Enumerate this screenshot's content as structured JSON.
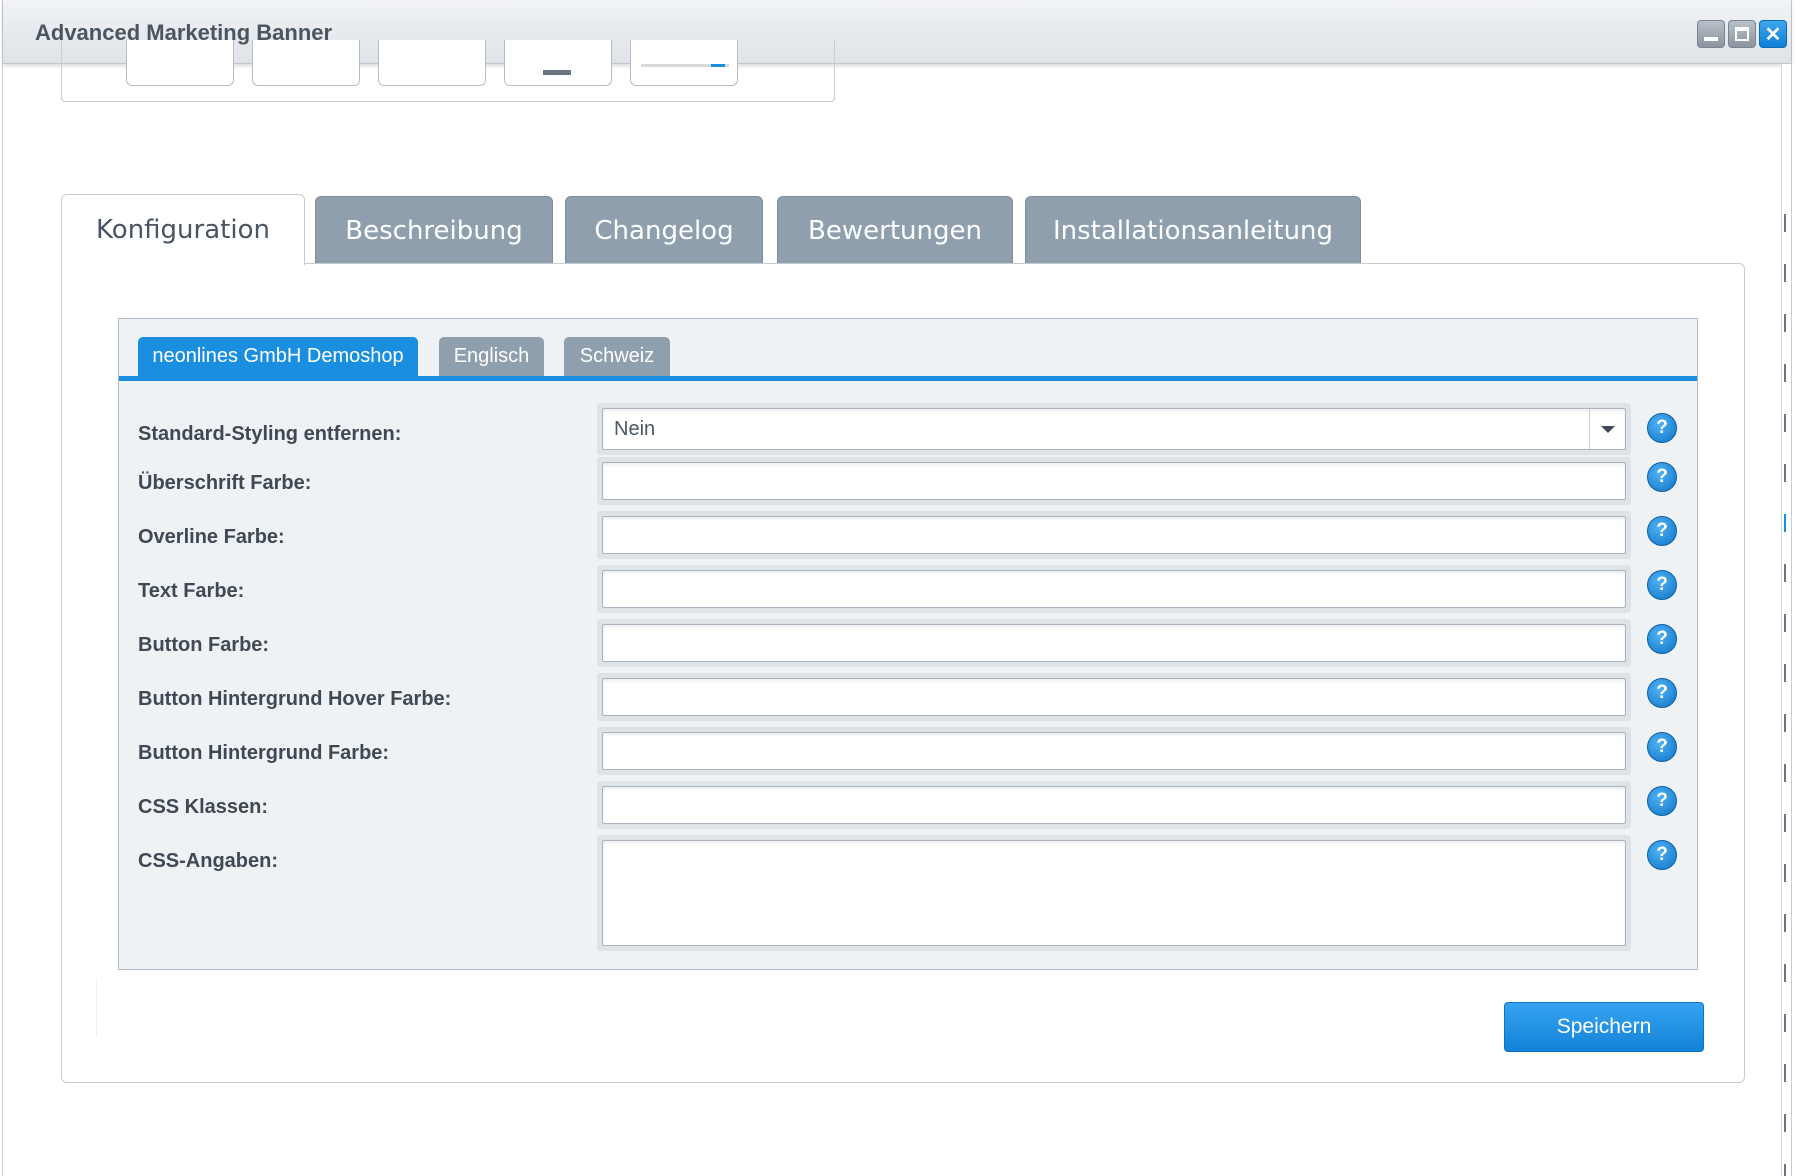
{
  "window": {
    "title": "Advanced Marketing Banner",
    "controls": [
      "minimize-icon",
      "maximize-icon",
      "close-icon"
    ]
  },
  "main_tabs": [
    {
      "label": "Konfiguration",
      "active": true
    },
    {
      "label": "Beschreibung",
      "active": false
    },
    {
      "label": "Changelog",
      "active": false
    },
    {
      "label": "Bewertungen",
      "active": false
    },
    {
      "label": "Installationsanleitung",
      "active": false
    }
  ],
  "shop_tabs": [
    {
      "label": "neonlines GmbH Demoshop",
      "active": true
    },
    {
      "label": "Englisch",
      "active": false
    },
    {
      "label": "Schweiz",
      "active": false
    }
  ],
  "form": {
    "rows": [
      {
        "label": "Standard-Styling entfernen:",
        "type": "select",
        "value": "Nein"
      },
      {
        "label": "Überschrift Farbe:",
        "type": "text",
        "value": ""
      },
      {
        "label": "Overline Farbe:",
        "type": "text",
        "value": ""
      },
      {
        "label": "Text Farbe:",
        "type": "text",
        "value": ""
      },
      {
        "label": "Button Farbe:",
        "type": "text",
        "value": ""
      },
      {
        "label": "Button Hintergrund Hover Farbe:",
        "type": "text",
        "value": ""
      },
      {
        "label": "Button Hintergrund Farbe:",
        "type": "text",
        "value": ""
      },
      {
        "label": "CSS Klassen:",
        "type": "text",
        "value": ""
      },
      {
        "label": "CSS-Angaben:",
        "type": "textarea",
        "value": ""
      }
    ],
    "help_icon": "?"
  },
  "save_button": "Speichern",
  "colors": {
    "accent": "#1a8fe0",
    "tab_inactive": "#8f9fae",
    "panel_bg": "#eff2f5"
  }
}
